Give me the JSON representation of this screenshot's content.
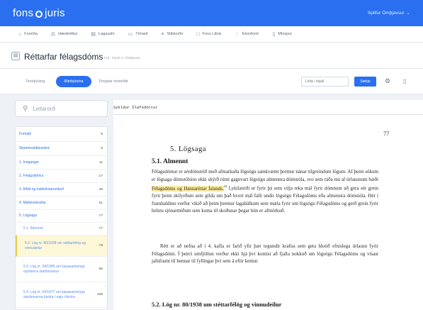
{
  "header": {
    "logo_left": "fons",
    "logo_right": "juris",
    "user_name": "Spilfur Ömþjavsur"
  },
  "nav": [
    {
      "icon": "home-icon",
      "label": "Forsíða"
    },
    {
      "icon": "gavel-icon",
      "label": "Hæstiréttur"
    },
    {
      "icon": "book-icon",
      "label": "Lagasafn"
    },
    {
      "icon": "document-icon",
      "label": "Tímarit"
    },
    {
      "icon": "list-icon",
      "label": "Stikkorðir"
    },
    {
      "icon": "folder-icon",
      "label": "Fons Libris"
    },
    {
      "icon": "bell-icon",
      "label": "Ekosferrir"
    },
    {
      "icon": "page-icon",
      "label": "Mínspur"
    }
  ],
  "title": {
    "label": "Réttarfar félagsdóms",
    "subtitle": "Höf.: Sindri H. Ómþjavsur"
  },
  "tabs": [
    "Textalýsing",
    "Ritnbjósina",
    "Tengdar heimildir"
  ],
  "find": {
    "placeholder": "Leita í skjali",
    "button": "Sækja"
  },
  "sidebar": {
    "search_placeholder": "Leitarorð",
    "items": [
      {
        "label": "Formáli",
        "page": "5",
        "level": 0
      },
      {
        "label": "Skammstafanaskrá",
        "page": "9",
        "level": 0
      },
      {
        "label": "1. Inngangur",
        "page": "11",
        "level": 0
      },
      {
        "label": "2. Félagsdómur",
        "page": "17",
        "level": 0
      },
      {
        "label": "3. Aðild og málsóknarumboð",
        "page": "39",
        "level": 0
      },
      {
        "label": "4. Málskostnaður",
        "page": "61",
        "level": 0
      },
      {
        "label": "5. Lögsaga",
        "page": "77",
        "level": 0
      },
      {
        "label": "5.1. Almennt",
        "page": "77",
        "level": 1
      },
      {
        "label": "5.2. Lög nr. 80/1938 um stéttarfélög og vinnudeilur",
        "page": "78",
        "level": 1
      },
      {
        "label": "5.3. Lög nr. 94/1986 um kjarasamninga opinberra starfsmanna",
        "page": "96",
        "level": 1
      },
      {
        "label": "5.4. Lög nr. 94/1977 um kjarasamninga starfsmanna banka í eigu ríkisins",
        "page": "108",
        "level": 1
      }
    ]
  },
  "document": {
    "stamp": "Sýkldur Ólafsdóttur",
    "page_number": "77",
    "section_heading": "5. Lögsaga",
    "subsection_heading": "5.1. Almennt",
    "para1_before": "Félagsdómur er sérdómstóll með afmarkaða lögsögu samkvæmt þremur nánar tilgreindum lögum. Af þeim sökum er lögsaga dómstólsins ekki skýrð rúmt gagnvart lögsögu almennra dómstóla, svo sem ráða má af úrlausnum bæði ",
    "para1_highlight": "Félagsdóms og Hæstaréttar Íslands.",
    "para1_sup": "34",
    "para1_after": " Lykilatriði er fyrir þá sem vilja reka mál fyrir dómnum að gera sér grein fyrir þeim skilyrðum sem gilda um það hvort mál falli undir lögsögu Félagsdóms eða almennra dómstóla. Hér í framhaldinu verður vikið að þeim þremur lagabálkum sem mæla fyrir um lögsögu Félagsdóms og gerð grein fyrir helstu sjónarmiðum sem koma til skoðunar þegar hún er afmörkuð.",
    "para2": "Rétt er að nefna að í 4. kafla er farið yfir þær tegundir krafna sem geta hlotið efnislega úrlausn fyrir Félagsdómi. Í þeirri umfjöllun verður ekki hjá því komist að fjalla nokkuð um lögsögu Félagsdóms og vísast jafnframt til hennar til fyllingar því sem á eftir kemur.",
    "next_heading": "5.2. Lög nr. 80/1938 um stéttarfélög og vinnudeilur"
  },
  "colors": {
    "accent": "#2a6ff0",
    "highlight": "#fbeaa0",
    "active_toc": "#fff8d8"
  }
}
